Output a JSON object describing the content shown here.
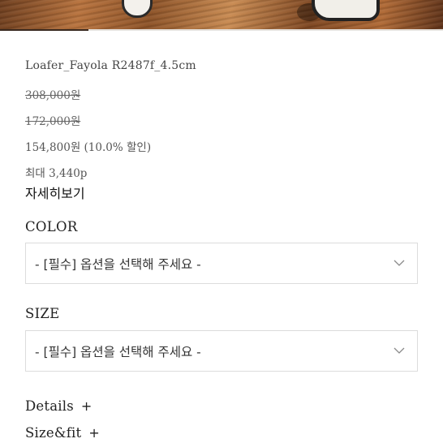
{
  "gallery": {
    "progress": 0.2
  },
  "product": {
    "name": "Loafer_Fayola R2487f_4.5cm",
    "price_original": "308,000원",
    "price_consumer": "172,000원",
    "price_sale": "154,800원 (10.0% 할인)",
    "points": "최대 3,440p",
    "detail_link": "자세히보기"
  },
  "options": {
    "color": {
      "label": "COLOR",
      "value": "- [필수] 옵션을 선택해 주세요 -"
    },
    "size": {
      "label": "SIZE",
      "value": "- [필수] 옵션을 선택해 주세요 -"
    }
  },
  "accordions": [
    {
      "label": "Details",
      "icon": "+"
    },
    {
      "label": "Size&fit",
      "icon": "+"
    }
  ],
  "icons": {
    "select_arrow": "chevron-down-icon",
    "expand": "plus-icon"
  },
  "colors": {
    "text": "#2b2b2b",
    "border": "#dcdcdc",
    "progress": "#3a2a20"
  }
}
